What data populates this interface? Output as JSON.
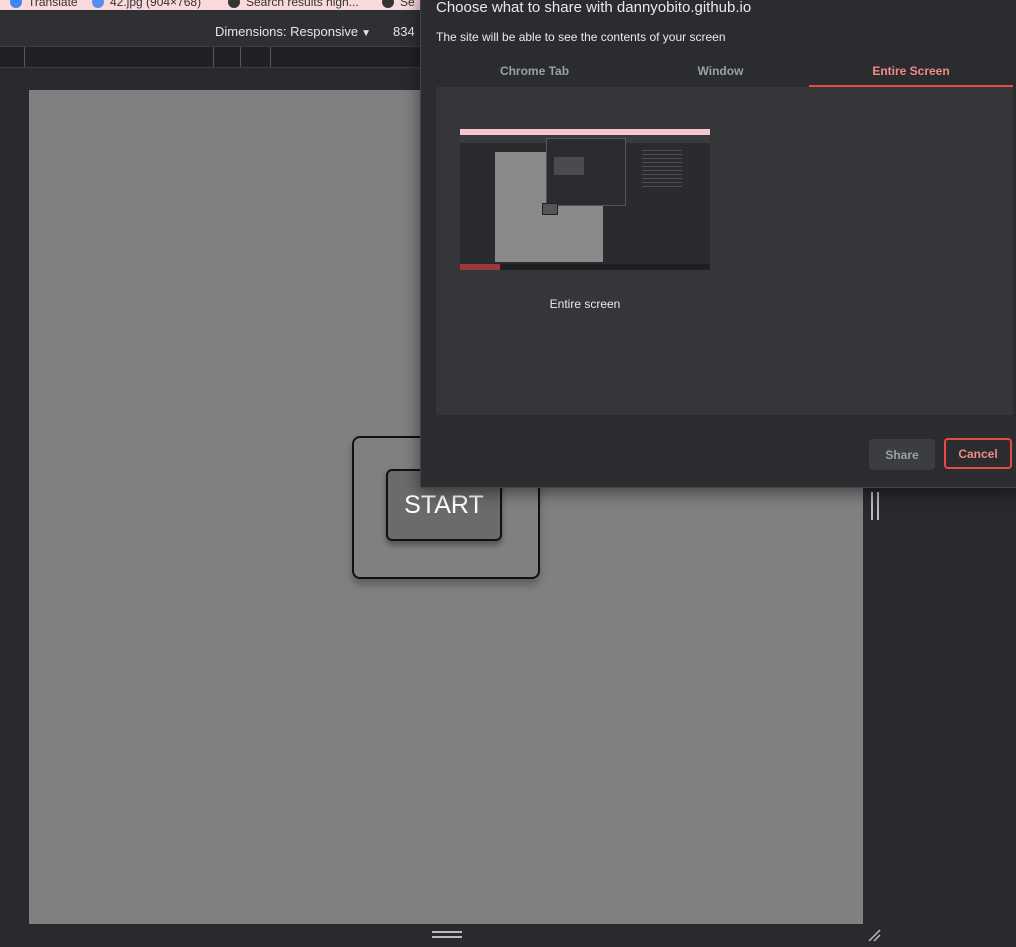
{
  "bookmarks": {
    "items": [
      {
        "label": "Translate",
        "icon": "translate-icon"
      },
      {
        "label": "42.jpg (904×768)",
        "icon": "image-icon"
      },
      {
        "label": "Search results high...",
        "icon": "globe-icon"
      },
      {
        "label": "Se",
        "icon": "globe-icon"
      }
    ]
  },
  "toolbar": {
    "dimensions_label": "Dimensions: Responsive",
    "width_value": "834"
  },
  "page": {
    "start_label": "START"
  },
  "dialog": {
    "title": "Choose what to share with dannyobito.github.io",
    "subtitle": "The site will be able to see the contents of your screen",
    "tabs": [
      {
        "label": "Chrome Tab",
        "active": false
      },
      {
        "label": "Window",
        "active": false
      },
      {
        "label": "Entire Screen",
        "active": true
      }
    ],
    "screen_label": "Entire screen",
    "share_label": "Share",
    "cancel_label": "Cancel"
  },
  "colors": {
    "accent": "#e74c3c",
    "page_bg": "#808080",
    "dialog_bg": "#2b2c2f"
  }
}
